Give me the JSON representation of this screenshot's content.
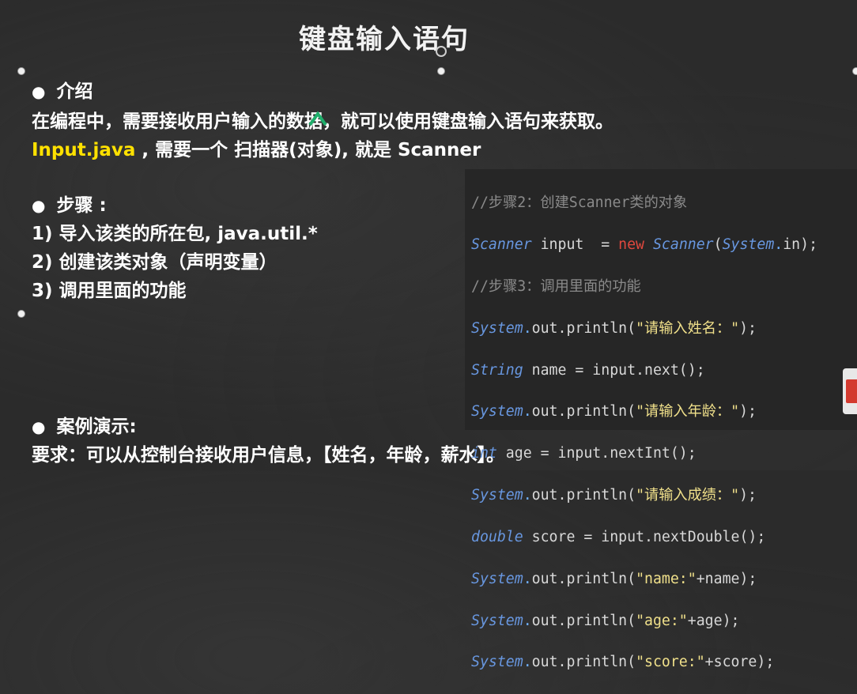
{
  "slide": {
    "title": "键盘输入语句",
    "intro_heading": "介绍",
    "intro_text": "在编程中，需要接收用户输入的数据，就可以使用键盘输入语句来获取。",
    "input_file": "Input.java",
    "input_desc": " , 需要一个 扫描器(对象), 就是 Scanner",
    "steps_heading": "步骤 :",
    "steps": [
      "1) 导入该类的所在包, java.util.*",
      "2) 创建该类对象（声明变量）",
      "3) 调用里面的功能"
    ],
    "case_heading": "案例演示:",
    "case_text": "要求：可以从控制台接收用户信息，【姓名，年龄，薪水】。"
  },
  "code": {
    "l1_comment": "//步骤2：创建Scanner类的对象",
    "l2_type": "Scanner",
    "l2_var": " input  = ",
    "l2_new": "new",
    "l2_type2": "Scanner",
    "l2_sys": "System",
    "l2_tail": "in);",
    "l3_comment": "//步骤3：调用里面的功能",
    "sys": "System",
    "out_println": "out.println(",
    "l4_str": "\"请输入姓名：\"",
    "l5_type": "String",
    "l5_rest": " name = input.next();",
    "l6_str": "\"请输入年龄：\"",
    "l7_type": "int",
    "l7_rest": " age = input.nextInt();",
    "l8_str": "\"请输入成绩：\"",
    "l9_type": "double",
    "l9_rest": " score = input.nextDouble();",
    "l10_str": "\"name:\"",
    "l10_tail": "+name);",
    "l11_str": "\"age:\"",
    "l11_tail": "+age);",
    "l12_str": "\"score:\"",
    "l12_tail": "+score);",
    "close_paren": ");"
  },
  "colors": {
    "background": "#2b2b2b",
    "accent_yellow": "#ffe100",
    "code_keyword": "#e0483e",
    "code_type": "#6897e0",
    "code_string": "#f0e08a",
    "code_comment": "#8a8a8a"
  }
}
